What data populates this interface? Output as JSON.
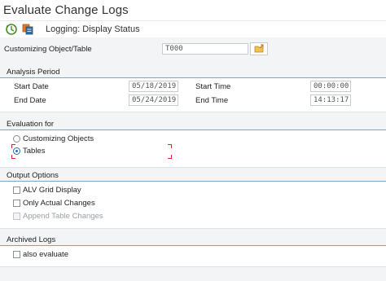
{
  "window": {
    "title": "Evaluate Change Logs"
  },
  "toolbar": {
    "execute_icon": "execute-clock-icon",
    "logging_icon": "logging-status-icon",
    "logging_label": "Logging: Display Status"
  },
  "selection": {
    "object_label": "Customizing Object/Table",
    "object_value": "T000",
    "browse_icon": "folder-open-icon"
  },
  "analysis_period": {
    "title": "Analysis Period",
    "start_date_label": "Start Date",
    "start_date_value": "05/18/2019",
    "end_date_label": "End Date",
    "end_date_value": "05/24/2019",
    "start_time_label": "Start Time",
    "start_time_value": "00:00:00",
    "end_time_label": "End Time",
    "end_time_value": "14:13:17"
  },
  "evaluation_for": {
    "title": "Evaluation for",
    "options": [
      {
        "label": "Customizing Objects",
        "selected": false
      },
      {
        "label": "Tables",
        "selected": true
      }
    ]
  },
  "output_options": {
    "title": "Output Options",
    "items": [
      {
        "label": "ALV Grid Display",
        "checked": false,
        "enabled": true
      },
      {
        "label": "Only Actual Changes",
        "checked": false,
        "enabled": true
      },
      {
        "label": "Append Table Changes",
        "checked": false,
        "enabled": false
      }
    ]
  },
  "archived_logs": {
    "title": "Archived Logs",
    "also_evaluate_label": "also evaluate"
  },
  "colors": {
    "accent": "#2f6eaa",
    "group_line": "#7ea6c4",
    "background": "#f2f4f5",
    "focus_marker": "#d0312d"
  }
}
